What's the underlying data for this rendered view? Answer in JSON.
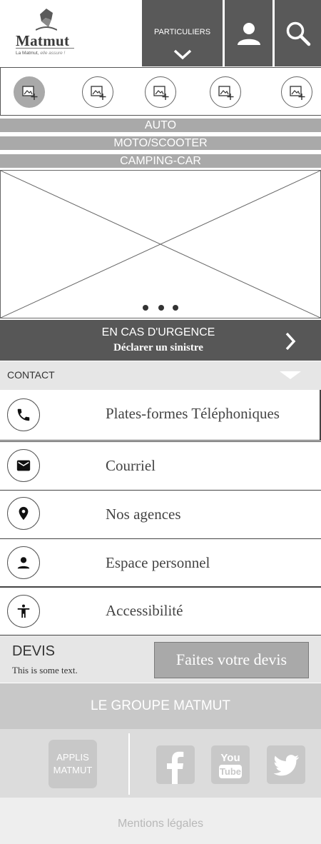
{
  "header": {
    "logo_name": "Matmut",
    "logo_tagline_plain": "La Matmut,",
    "logo_tagline_italic": " elle assure !",
    "particuliers_label": "PARTICULIERS",
    "icons": [
      "chevron-down-icon",
      "user-icon",
      "search-icon"
    ]
  },
  "image_strip": {
    "items": [
      {
        "icon": "image-add-icon",
        "active": true
      },
      {
        "icon": "image-add-icon",
        "active": false
      },
      {
        "icon": "image-add-icon",
        "active": false
      },
      {
        "icon": "image-add-icon",
        "active": false
      },
      {
        "icon": "image-add-icon",
        "active": false
      }
    ]
  },
  "categories": [
    "AUTO",
    "MOTO/SCOOTER",
    "CAMPING-CAR"
  ],
  "carousel": {
    "dot_count": 3
  },
  "urgence": {
    "title": "EN CAS D'URGENCE",
    "subtitle": "Déclarer un sinistre"
  },
  "contact": {
    "header_label": "CONTACT",
    "items": [
      {
        "label": "Plates-formes Téléphoniques",
        "icon": "phone-icon"
      },
      {
        "label": "Courriel",
        "icon": "mail-icon"
      },
      {
        "label": "Nos agences",
        "icon": "location-pin-icon"
      },
      {
        "label": "Espace personnel",
        "icon": "user-icon"
      },
      {
        "label": "Accessibilité",
        "icon": "accessibility-icon"
      }
    ]
  },
  "devis": {
    "title": "DEVIS",
    "text": "This is some text.",
    "button_label": "Faites votre devis"
  },
  "footer": {
    "groupe_label": "LE GROUPE MATMUT",
    "applis_line1": "APPLIS",
    "applis_line2": "MATMUT",
    "social_icons": [
      "facebook-icon",
      "youtube-icon",
      "twitter-icon"
    ],
    "youtube_line1": "You",
    "youtube_line2": "Tube",
    "mentions_label": "Mentions légales"
  },
  "colors": {
    "dark_gray": "#595959",
    "mid_gray": "#a9a9a9",
    "light_gray": "#e6e6e6",
    "footer_gray": "#c8c8c8"
  }
}
